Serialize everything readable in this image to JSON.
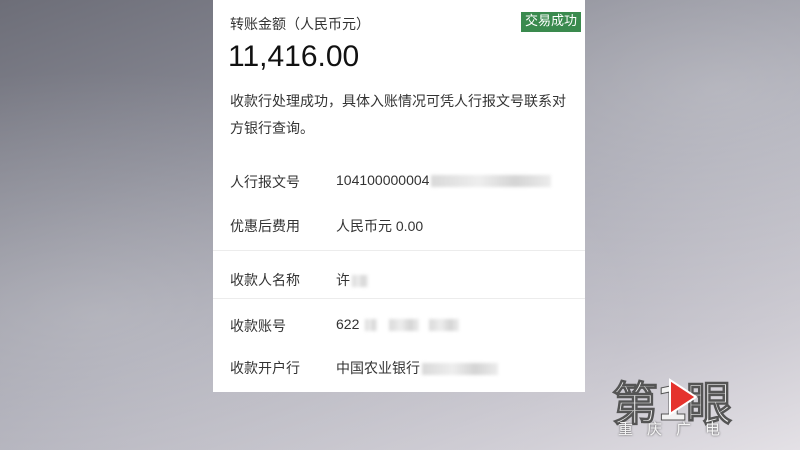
{
  "card": {
    "amount_label": "转账金额（人民币元）",
    "status_badge": "交易成功",
    "amount": "11,416.00",
    "description": "收款行处理成功，具体入账情况可凭人行报文号联系对方银行查询。"
  },
  "details": {
    "ref_label": "人行报文号",
    "ref_value": "104100000004",
    "fee_label": "优惠后费用",
    "fee_value": "人民币元 0.00",
    "payee_label": "收款人名称",
    "payee_value": "许",
    "account_label": "收款账号",
    "account_value": "622",
    "bank_label": "收款开户行",
    "bank_value": "中国农业银行"
  },
  "watermark": {
    "main": "第1眼",
    "sub": "重庆广电"
  },
  "colors": {
    "badge": "#3a8a4e",
    "logo_accent": "#e5322d"
  }
}
